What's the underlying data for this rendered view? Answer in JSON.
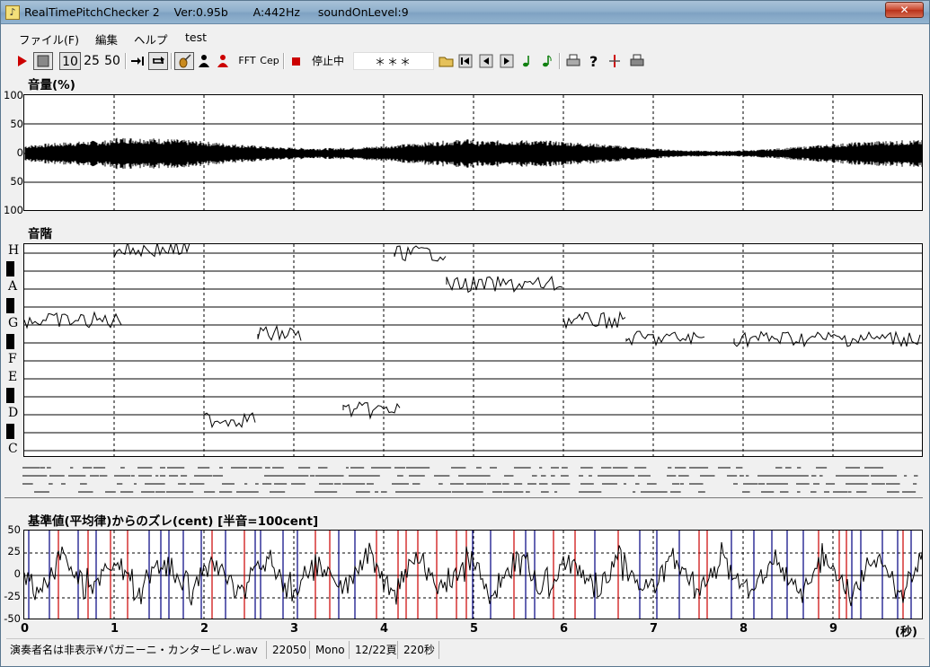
{
  "window": {
    "title": "RealTimePitchChecker 2    Ver:0.95b       A:442Hz     soundOnLevel:9",
    "close_label": "✕"
  },
  "menu": [
    "ファイル(F)",
    "編集",
    "ヘルプ",
    "test"
  ],
  "toolbar": {
    "speed_options": [
      "10",
      "25",
      "50"
    ],
    "fft_label": "FFT",
    "cep_label": "Cep",
    "status_label": "停止中",
    "note_display": "＊＊＊"
  },
  "volume_panel": {
    "title": "音量(%)",
    "y_labels": [
      "100",
      "50",
      "0",
      "50",
      "100"
    ]
  },
  "scale_panel": {
    "title": "音階",
    "note_labels": [
      "H",
      "A",
      "G",
      "F",
      "E",
      "D",
      "C"
    ]
  },
  "deviation_panel": {
    "title": "基準値(平均律)からのズレ(cent) [半音=100cent]",
    "y_labels": [
      "50",
      "25",
      "0",
      "-25",
      "-50"
    ],
    "x_labels": [
      "0",
      "1",
      "2",
      "3",
      "4",
      "5",
      "6",
      "7",
      "8",
      "9"
    ],
    "x_unit": "(秒)"
  },
  "statusbar": {
    "file": "演奏者名は非表示¥パガニーニ・カンタービレ.wav",
    "rate": "22050",
    "channels": "Mono",
    "page": "12/22頁",
    "duration": "220秒"
  },
  "colors": {
    "red_marker": "#cc0000",
    "blue_marker": "#000080",
    "trace": "#000000"
  }
}
